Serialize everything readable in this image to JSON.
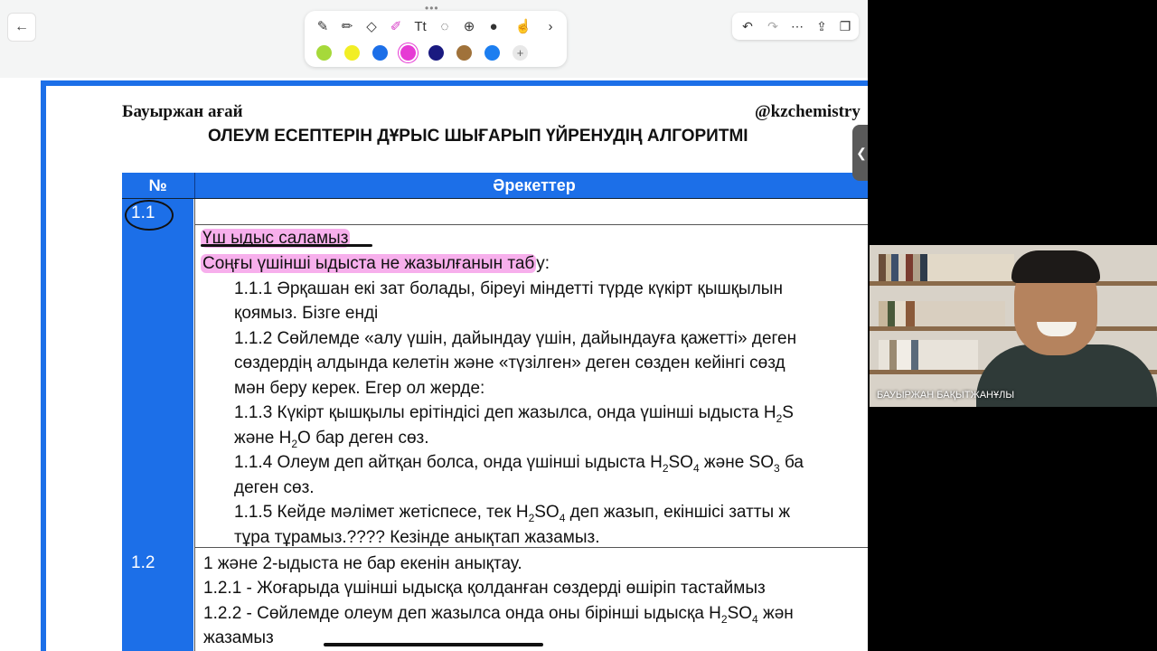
{
  "toolbar": {
    "back_icon": "←",
    "more_icon": "•••",
    "tools": [
      "pen-icon",
      "pencil-icon",
      "eraser-icon",
      "highlighter-icon",
      "text-icon",
      "lasso-icon",
      "add-icon",
      "mic-icon",
      "touch-icon",
      "chevron-right-icon"
    ],
    "swatch_colors": [
      "#a6d93a",
      "#f2ee25",
      "#1c6fe8",
      "#e63bd4",
      "#1a1a80",
      "#a0723a",
      "#1c7ef0"
    ],
    "add_color": "+",
    "right_tools": [
      "undo-icon",
      "redo-icon",
      "more-icon",
      "export-icon",
      "pages-icon"
    ]
  },
  "document": {
    "author": "Бауыржан ағай",
    "handle": "@kzchemistry",
    "title": "ОЛЕУМ ЕСЕПТЕРІН ДҰРЫС ШЫҒАРЫП ҮЙРЕНУДІҢ АЛГОРИТМІ",
    "table": {
      "col_num": "№",
      "col_actions": "Әрекеттер",
      "row1_num": "1.1",
      "row2_num": "1.2",
      "lines": {
        "l1": "Үш ыдыс саламыз",
        "l2a": "Соңғы үшінші ыдыста не жазылғанын таб",
        "l2b": "у:",
        "l3": "1.1.1 Әрқашан екі зат болады, біреуі міндетті түрде күкірт қышқылын",
        "l4": "қоямыз. Бізге енді",
        "l5": "1.1.2 Сөйлемде «алу үшін, дайындау үшін, дайындауға қажетті» деген",
        "l6": "сөздердің алдында келетін және «түзілген» деген сөзден кейінгі сөзд",
        "l7": "мән беру керек. Егер ол жерде:",
        "l8a": "1.1.3 Күкірт қышқылы ерітіндісі деп жазылса, онда үшінші ыдыста H",
        "l8sub": "2",
        "l8b": "S",
        "l9a": "және H",
        "l9sub": "2",
        "l9b": "O бар деген сөз.",
        "l10a": "1.1.4 Олеум деп айтқан болса, онда үшінші ыдыста H",
        "l10sub1": "2",
        "l10b": "SO",
        "l10sub2": "4",
        "l10c": " және SO",
        "l10sub3": "3",
        "l10d": " ба",
        "l11": "деген сөз.",
        "l12a": "1.1.5 Кейде мәлімет жетіспесе, тек H",
        "l12sub1": "2",
        "l12b": "SO",
        "l12sub2": "4",
        "l12c": " деп жазып, екіншісі затты ж",
        "l13": "тұра тұрамыз.????  Кезінде анықтап жазамыз.",
        "m1": "1 және 2-ыдыста не бар екенін анықтау.",
        "m2": "1.2.1 - Жоғарыда үшінші ыдысқа қолданған сөздерді өшіріп тастаймыз",
        "m3a": "1.2.2 - Сөйлемде олеум деп жазылса онда оны бірінші ыдысқа H",
        "m3sub1": "2",
        "m3b": "SO",
        "m3sub2": "4",
        "m3c": " жән",
        "m4": "жазамыз"
      }
    }
  },
  "video": {
    "participant_name": "БАУЫРЖАН БАҚЫТЖАНҰЛЫ"
  }
}
